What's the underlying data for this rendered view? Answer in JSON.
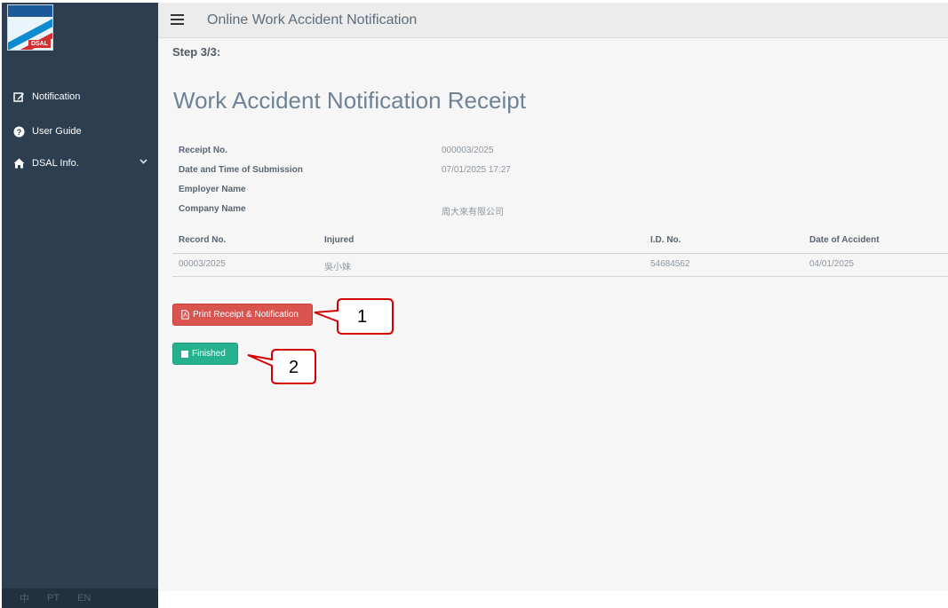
{
  "sidebar": {
    "logo_text": "DSAL",
    "items": [
      {
        "label": "Notification",
        "icon": "edit-icon"
      },
      {
        "label": "User Guide",
        "icon": "question-circle-icon"
      },
      {
        "label": "DSAL Info.",
        "icon": "home-icon"
      }
    ],
    "languages": [
      "中",
      "PT",
      "EN"
    ]
  },
  "header": {
    "title": "Online Work Accident Notification"
  },
  "main": {
    "step": "Step 3/3:",
    "page_title": "Work Accident Notification Receipt",
    "info": [
      {
        "label": "Receipt No.",
        "value": "000003/2025"
      },
      {
        "label": "Date and Time of Submission",
        "value": "07/01/2025 17:27"
      },
      {
        "label": "Employer Name",
        "value": ""
      },
      {
        "label": "Company Name",
        "value": "周大來有限公司"
      }
    ],
    "table": {
      "headers": [
        "Record No.",
        "Injured",
        "I.D. No.",
        "Date of Accident"
      ],
      "rows": [
        [
          "00003/2025",
          "吳小妹",
          "54684562",
          "04/01/2025"
        ]
      ]
    },
    "buttons": {
      "print_label": "Print Receipt & Notification",
      "finish_label": "Finished"
    }
  },
  "callouts": [
    "1",
    "2"
  ],
  "colors": {
    "sidebar": "#2c3e50",
    "print_button": "#d9534f",
    "finish_button": "#26b28f",
    "title": "#6f8296",
    "callout": "#d40000"
  }
}
